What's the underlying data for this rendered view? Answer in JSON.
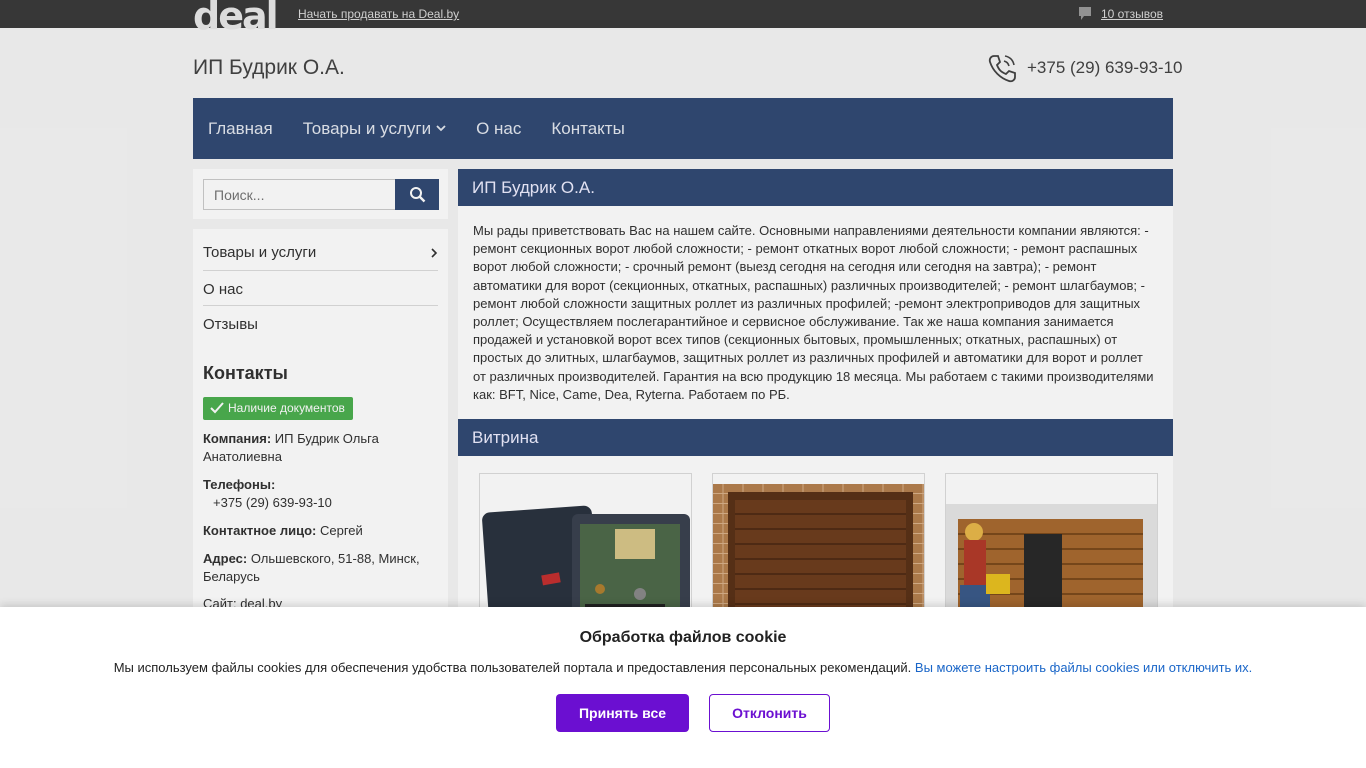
{
  "topbar": {
    "logo": "deal",
    "sell_link": "Начать продавать на Deal.by",
    "reviews_link": "10 отзывов",
    "reviews_icon": "comment-icon"
  },
  "header": {
    "company_name": "ИП Будрик О.А.",
    "phone": "+375 (29) 639-93-10",
    "phone_icon": "phone-icon"
  },
  "nav": {
    "items": [
      {
        "label": "Главная"
      },
      {
        "label": "Товары и услуги",
        "has_dropdown": true
      },
      {
        "label": "О нас"
      },
      {
        "label": "Контакты"
      }
    ]
  },
  "sidebar": {
    "search_placeholder": "Поиск...",
    "menu": [
      {
        "label": "Товары и услуги",
        "has_arrow": true
      },
      {
        "label": "О нас"
      },
      {
        "label": "Отзывы"
      }
    ],
    "contacts_title": "Контакты",
    "docs_badge": "Наличие документов",
    "company_label": "Компания:",
    "company_value": "ИП Будрик Ольга Анатолиевна",
    "phones_label": "Телефоны:",
    "phones_value": "+375 (29) 639-93-10",
    "contact_person_label": "Контактное лицо:",
    "contact_person_value": "Сергей",
    "address_label": "Адрес:",
    "address_value": "Ольшевского, 51-88, Минск, Беларусь",
    "site_partial": "Сайт: deal.by"
  },
  "main": {
    "title": "ИП Будрик О.А.",
    "about": "Мы рады приветствовать Вас на нашем сайте. Основными направлениями деятельности компании являются: - ремонт секционных ворот любой сложности; - ремонт откатных ворот любой сложности; - ремонт распашных ворот любой сложности; - срочный ремонт (выезд сегодня на сегодня или сегодня на завтра); - ремонт автоматики для ворот (секционных, откатных, распашных) различных производителей; - ремонт шлагбаумов; - ремонт любой сложности защитных роллет из различных профилей; -ремонт электроприводов для защитных роллет; Осуществляем послегарантийное и сервисное обслуживание. Так же наша компания занимается продажей и установкой ворот всех типов (секционных бытовых, промышленных; откатных, распашных) от простых до элитных, шлагбаумов, защитных роллет из различных профилей и автоматики для ворот и роллет от различных производителей. Гарантия на всю продукцию 18 месяца. Мы работаем с такими производителями как: BFT, Nice, Came, Dea, Ryterna. Работаем по РБ.",
    "vitrina_title": "Витрина",
    "products": [
      {
        "image": "control-box-image"
      },
      {
        "image": "garage-door-image"
      },
      {
        "image": "worker-gate-image"
      }
    ]
  },
  "cookie": {
    "title": "Обработка файлов cookie",
    "text": "Мы используем файлы cookies для обеспечения удобства пользователей портала и предоставления персональных рекомендаций.",
    "link": "Вы можете настроить файлы cookies или отключить их.",
    "accept": "Принять все",
    "decline": "Отклонить",
    "accent_color": "#6b0fd1"
  },
  "colors": {
    "nav_bg": "#324a74",
    "topbar_bg": "#3a3a3a",
    "badge_green": "#4caf50"
  }
}
